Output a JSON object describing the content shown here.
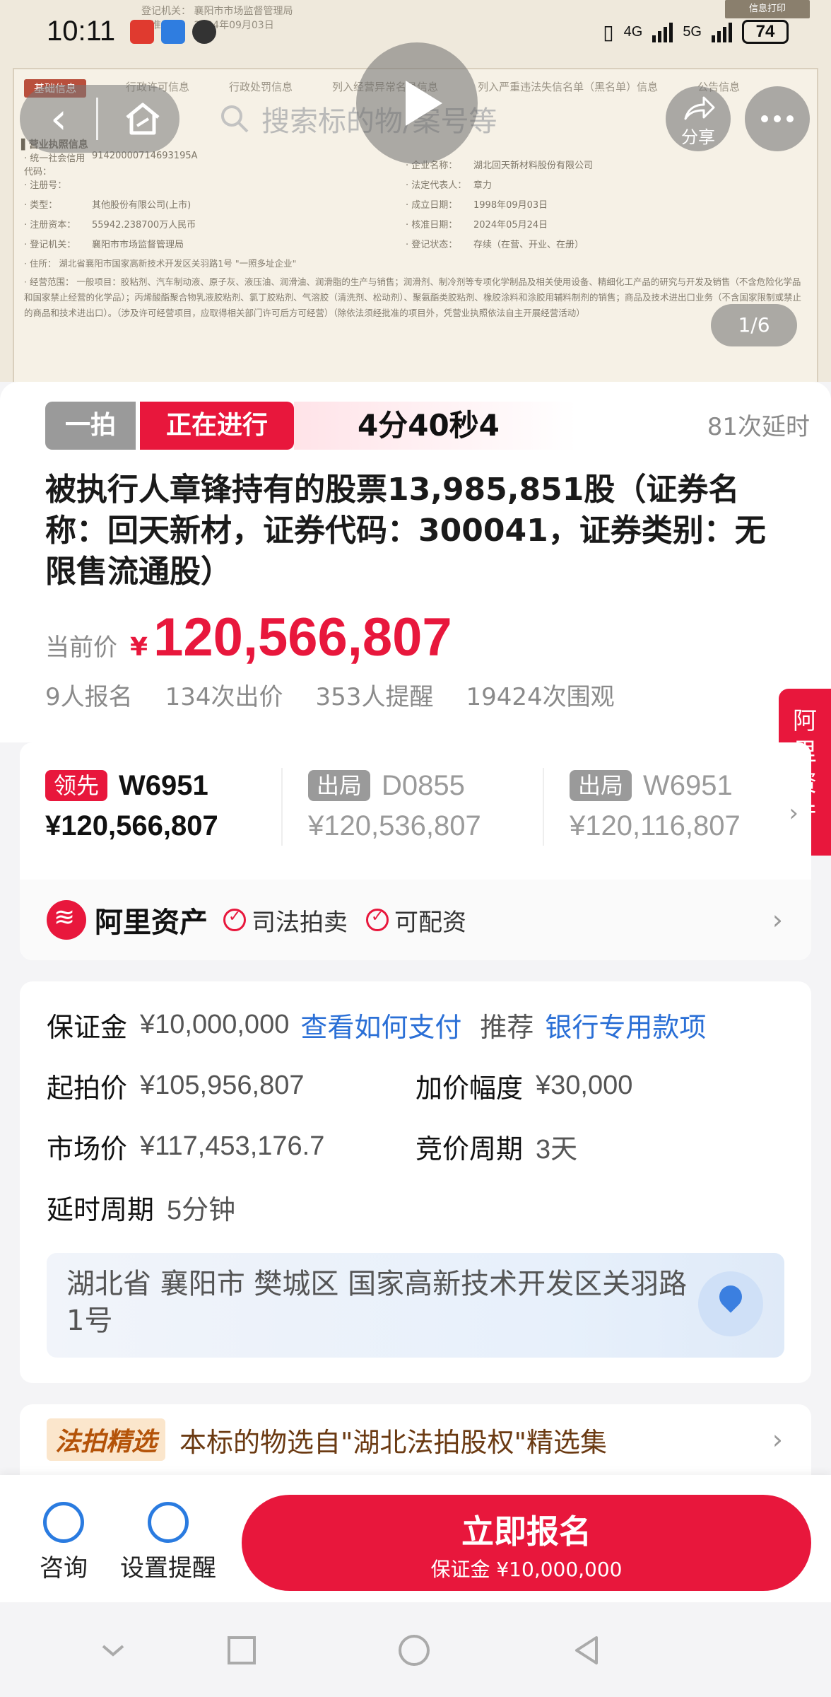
{
  "status_bar": {
    "time": "10:11",
    "network": "4G",
    "network2": "5G",
    "battery": "74"
  },
  "document": {
    "ghost_top": [
      "登记机关：  襄阳市市场监督管理局",
      "核准日期： 2024年09月03日"
    ],
    "ghost_btn": "信息打印",
    "tabs": [
      "基础信息",
      "行政许可信息",
      "行政处罚信息",
      "列入经营异常名录信息",
      "列入严重违法失信名单（黑名单）信息",
      "公告信息"
    ],
    "section": "▌营业执照信息",
    "rows": [
      {
        "lk": "· 统一社会信用代码：",
        "lv": "91420000714693195A",
        "rk": "· 企业名称：",
        "rv": "湖北回天新材料股份有限公司"
      },
      {
        "lk": "· 注册号：",
        "lv": "",
        "rk": "· 法定代表人：",
        "rv": "章力"
      },
      {
        "lk": "· 类型：",
        "lv": "其他股份有限公司(上市)",
        "rk": "· 成立日期：",
        "rv": "1998年09月03日"
      },
      {
        "lk": "· 注册资本：",
        "lv": "55942.238700万人民币",
        "rk": "· 核准日期：",
        "rv": "2024年05月24日"
      },
      {
        "lk": "· 登记机关：",
        "lv": "襄阳市市场监督管理局",
        "rk": "· 登记状态：",
        "rv": "存续（在营、开业、在册）"
      }
    ],
    "address": "· 住所：    湖北省襄阳市国家高新技术开发区关羽路1号 \"一照多址企业\"",
    "scope": "· 经营范围：    一般项目：胶粘剂、汽车制动液、原子灰、液压油、润滑油、润滑脂的生产与销售；润滑剂、制冷剂等专项化学制品及相关使用设备、精细化工产品的研究与开发及销售（不含危险化学品和国家禁止经营的化学品）；丙烯酸酯聚合物乳液胶粘剂、氯丁胶粘剂、气溶胶（清洗剂、松动剂）、聚氨酯类胶粘剂、橡胶涂料和涂胶用辅料制剂的销售；商品及技术进出口业务（不含国家限制或禁止的商品和技术进出口）。（涉及许可经营项目，应取得相关部门许可后方可经营）（除依法须经批准的项目外，凭营业执照依法自主开展经营活动）"
  },
  "nav": {
    "search_placeholder": "搜索标的物/案号等",
    "share_label": "分享",
    "pager": "1/6"
  },
  "auction": {
    "badge_type": "一拍",
    "badge_status": "正在进行",
    "countdown": "4分40秒4",
    "delays": "81次延时",
    "title": "被执行人章锋持有的股票13,985,851股（证券名称：回天新材，证券代码：300041，证券类别：无限售流通股）",
    "price_label": "当前价",
    "price_symbol": "¥",
    "price": "120,566,807",
    "stats": [
      "9人报名",
      "134次出价",
      "353人提醒",
      "19424次围观"
    ]
  },
  "side_tab": "阿里资产",
  "bids": [
    {
      "tag": "领先",
      "code": "W6951",
      "price": "¥120,566,807",
      "status": "lead"
    },
    {
      "tag": "出局",
      "code": "D0855",
      "price": "¥120,536,807",
      "status": "out"
    },
    {
      "tag": "出局",
      "code": "W6951",
      "price": "¥120,116,807",
      "status": "out"
    }
  ],
  "platform": {
    "name": "阿里资产",
    "features": [
      "司法拍卖",
      "可配资"
    ]
  },
  "info": {
    "deposit_label": "保证金",
    "deposit": "¥10,000,000",
    "deposit_link": "查看如何支付",
    "recommend_label": "推荐",
    "recommend_link": "银行专用款项",
    "start_label": "起拍价",
    "start": "¥105,956,807",
    "increment_label": "加价幅度",
    "increment": "¥30,000",
    "market_label": "市场价",
    "market": "¥117,453,176.7",
    "cycle_label": "竞价周期",
    "cycle": "3天",
    "delay_label": "延时周期",
    "delay": "5分钟",
    "address": "湖北省 襄阳市 樊城区 国家高新技术开发区关羽路1号"
  },
  "featured": {
    "tag": "法拍精选",
    "text": "本标的物选自\"湖北法拍股权\"精选集"
  },
  "bottom": {
    "consult": "咨询",
    "remind": "设置提醒",
    "cta_main": "立即报名",
    "cta_sub": "保证金 ¥10,000,000"
  },
  "colors": {
    "accent": "#e8173c",
    "link": "#2a6fd6"
  }
}
